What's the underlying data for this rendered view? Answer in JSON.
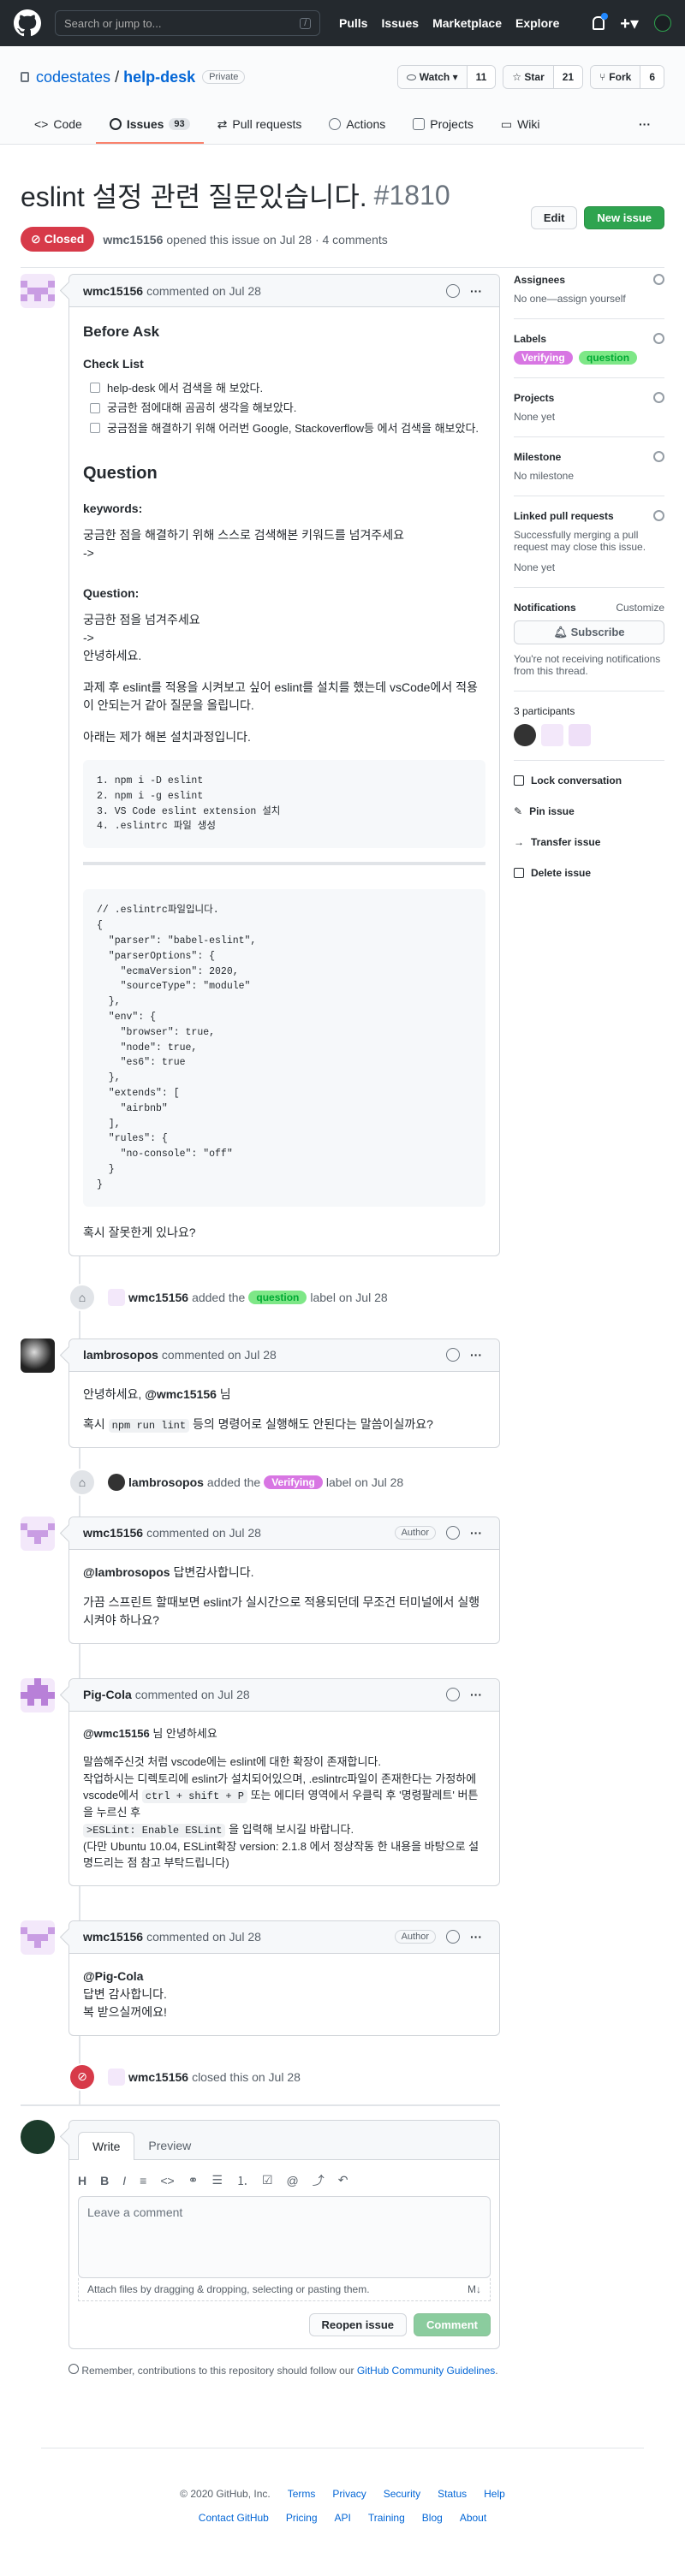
{
  "header": {
    "search_placeholder": "Search or jump to...",
    "slash": "/",
    "nav": [
      "Pulls",
      "Issues",
      "Marketplace",
      "Explore"
    ]
  },
  "repo": {
    "owner": "codestates",
    "sep": "/",
    "name": "help-desk",
    "visibility": "Private",
    "watch": {
      "label": "Watch ▾",
      "count": "11"
    },
    "star": {
      "label": "☆ Star",
      "count": "21"
    },
    "fork": {
      "label": "Fork",
      "count": "6"
    },
    "tabs": [
      {
        "label": "Code"
      },
      {
        "label": "Issues",
        "count": "93"
      },
      {
        "label": "Pull requests"
      },
      {
        "label": "Actions"
      },
      {
        "label": "Projects"
      },
      {
        "label": "Wiki"
      }
    ],
    "more": "···"
  },
  "issue": {
    "title": "eslint 설정 관련 질문있습니다.",
    "number": "#1810",
    "status": "Closed",
    "author": "wmc15156",
    "meta": "opened this issue on Jul 28 · 4 comments",
    "edit": "Edit",
    "new": "New issue"
  },
  "first": {
    "author": "wmc15156",
    "meta": "commented on Jul 28",
    "before_ask": "Before Ask",
    "checklist": "Check List",
    "tasks": [
      "help-desk 에서 검색을 해 보았다.",
      "궁금한 점에대해 곰곰히 생각을 해보았다.",
      "궁금점을 해결하기 위해 어러번 Google, Stackoverflow등 에서 검색을 해보았다."
    ],
    "question_h": "Question",
    "kw_h": "keywords:",
    "kw_text": "궁금한 점을 해결하기 위해 스스로 검색해본 키워드를 넘겨주세요",
    "arrow": "->",
    "q_h": "Question:",
    "q1": "궁금한 점을 넘겨주세요",
    "q2": "->",
    "q3": "안녕하세요.",
    "p1": "과제 후 eslint를 적용을 시켜보고 싶어 eslint를 설치를 했는데 vsCode에서 적용이 안되는거 같아 질문을 올립니다.",
    "p2": "아래는 제가 해본 설치과정입니다.",
    "code1": "1. npm i -D eslint\n2. npm i -g eslint\n3. VS Code eslint extension 설치\n4. .eslintrc 파일 생성",
    "code2": "// .eslintrc파일입니다.\n{\n  \"parser\": \"babel-eslint\",\n  \"parserOptions\": {\n    \"ecmaVersion\": 2020,\n    \"sourceType\": \"module\"\n  },\n  \"env\": {\n    \"browser\": true,\n    \"node\": true,\n    \"es6\": true\n  },\n  \"extends\": [\n    \"airbnb\"\n  ],\n  \"rules\": {\n    \"no-console\": \"off\"\n  }\n}",
    "end": "혹시 잘못한게 있나요?"
  },
  "ev1": {
    "actor": "wmc15156",
    "pre": "added the",
    "label": "question",
    "post": "label on Jul 28",
    "label_color": "#7ee787"
  },
  "c2": {
    "author": "lambrosopos",
    "meta": "commented on Jul 28",
    "l1a": "안녕하세요,",
    "l1b": "@wmc15156",
    "l1c": "님",
    "l2a": "혹시",
    "l2code": "npm run lint",
    "l2b": "등의 명령어로 실행해도 안된다는 말씀이실까요?"
  },
  "ev2": {
    "actor": "lambrosopos",
    "pre": "added the",
    "label": "Verifying",
    "post": "label on Jul 28",
    "label_color": "#d876e3"
  },
  "c3": {
    "author": "wmc15156",
    "meta": "commented on Jul 28",
    "badge": "Author",
    "l1a": "@lambrosopos",
    "l1b": "답변감사합니다.",
    "l2": "가끔 스프린트 할때보면 eslint가 실시간으로 적용되던데 무조건 터미널에서 실행시켜야 하나요?"
  },
  "c4": {
    "author": "Pig-Cola",
    "meta": "commented on Jul 28",
    "l1a": "@wmc15156",
    "l1b": "님 안녕하세요",
    "l2": "말씀해주신것 처럼 vscode에는 eslint에 대한 확장이 존재합니다.",
    "l3": "작업하시는 디렉토리에 eslint가 설치되어있으며, .eslintrc파일이 존재한다는 가정하에",
    "l4a": "vscode에서",
    "l4code": "ctrl + shift + P",
    "l4b": "또는 에디터 영역에서 우클릭 후 '명령팔레트' 버튼을 누르신 후",
    "l5code": ">ESLint: Enable ESLint",
    "l5b": "을 입력해 보시길 바랍니다.",
    "l6": "(다만 Ubuntu 10.04, ESLint확장 version: 2.1.8 에서 정상작동 한 내용을 바탕으로 설명드리는 점 참고 부탁드립니다)"
  },
  "c5": {
    "author": "wmc15156",
    "meta": "commented on Jul 28",
    "badge": "Author",
    "l1": "@Pig-Cola",
    "l2": "답변 감사합니다.",
    "l3": "복 받으실꺼에요!"
  },
  "ev3": {
    "actor": "wmc15156",
    "post": "closed this on Jul 28"
  },
  "reply": {
    "write": "Write",
    "preview": "Preview",
    "placeholder": "Leave a comment",
    "attach": "Attach files by dragging & dropping, selecting or pasting them.",
    "reopen": "Reopen issue",
    "comment": "Comment",
    "note_a": "Remember, contributions to this repository should follow our",
    "note_link": "GitHub Community Guidelines",
    "note_b": "."
  },
  "sidebar": {
    "assignees": "Assignees",
    "assignees_v": "No one—assign yourself",
    "labels": "Labels",
    "labels_v": [
      "Verifying",
      "question"
    ],
    "projects": "Projects",
    "projects_v": "None yet",
    "milestone": "Milestone",
    "milestone_v": "No milestone",
    "linked": "Linked pull requests",
    "linked_d": "Successfully merging a pull request may close this issue.",
    "linked_v": "None yet",
    "notif": "Notifications",
    "customize": "Customize",
    "subscribe": "Subscribe",
    "notif_d": "You're not receiving notifications from this thread.",
    "participants": "3 participants",
    "lock": "Lock conversation",
    "pin": "Pin issue",
    "transfer": "Transfer issue",
    "delete": "Delete issue"
  },
  "footer": {
    "copy": "© 2020 GitHub, Inc.",
    "row1": [
      "Terms",
      "Privacy",
      "Security",
      "Status",
      "Help"
    ],
    "row2": [
      "Contact GitHub",
      "Pricing",
      "API",
      "Training",
      "Blog",
      "About"
    ]
  }
}
